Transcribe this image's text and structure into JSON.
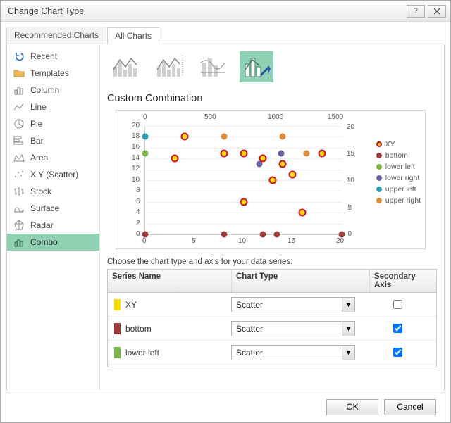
{
  "title": "Change Chart Type",
  "tabs": {
    "recommended": "Recommended Charts",
    "all": "All Charts"
  },
  "sidebar": {
    "items": [
      {
        "label": "Recent",
        "icon": "undo"
      },
      {
        "label": "Templates",
        "icon": "folder"
      },
      {
        "label": "Column",
        "icon": "column"
      },
      {
        "label": "Line",
        "icon": "line"
      },
      {
        "label": "Pie",
        "icon": "pie"
      },
      {
        "label": "Bar",
        "icon": "bar"
      },
      {
        "label": "Area",
        "icon": "area"
      },
      {
        "label": "X Y (Scatter)",
        "icon": "scatter"
      },
      {
        "label": "Stock",
        "icon": "stock"
      },
      {
        "label": "Surface",
        "icon": "surface"
      },
      {
        "label": "Radar",
        "icon": "radar"
      },
      {
        "label": "Combo",
        "icon": "combo"
      }
    ],
    "selected": 11
  },
  "section_title": "Custom Combination",
  "instruction": "Choose the chart type and axis for your data series:",
  "table": {
    "headers": {
      "name": "Series Name",
      "type": "Chart Type",
      "sec": "Secondary Axis"
    },
    "rows": [
      {
        "name": "XY",
        "type": "Scatter",
        "color": "#ffdb00",
        "secondary": false
      },
      {
        "name": "bottom",
        "type": "Scatter",
        "color": "#9e3c3c",
        "secondary": true
      },
      {
        "name": "lower left",
        "type": "Scatter",
        "color": "#7ab648",
        "secondary": true
      }
    ]
  },
  "buttons": {
    "ok": "OK",
    "cancel": "Cancel"
  },
  "legend": [
    {
      "name": "XY",
      "color": "#c8102e",
      "ring": true
    },
    {
      "name": "bottom",
      "color": "#9e3c3c"
    },
    {
      "name": "lower left",
      "color": "#7ab648"
    },
    {
      "name": "lower right",
      "color": "#6b5ca5"
    },
    {
      "name": "upper left",
      "color": "#2f9ab0"
    },
    {
      "name": "upper right",
      "color": "#e08a3b"
    }
  ],
  "chart_data": {
    "type": "scatter",
    "title": "",
    "x_primary": {
      "min": 0,
      "max": 20,
      "ticks": [
        0,
        5,
        10,
        15,
        20
      ],
      "label": ""
    },
    "y_primary": {
      "min": 0,
      "max": 20,
      "ticks": [
        0,
        2,
        4,
        6,
        8,
        10,
        12,
        14,
        16,
        18,
        20
      ],
      "label": ""
    },
    "x_secondary": {
      "min": 0,
      "max": 1500,
      "ticks": [
        0,
        500,
        1000,
        1500
      ]
    },
    "series": [
      {
        "name": "XY",
        "axis": "primary",
        "points": [
          [
            3,
            14
          ],
          [
            4,
            18
          ],
          [
            8,
            15
          ],
          [
            10,
            15
          ],
          [
            10,
            6
          ],
          [
            12,
            14
          ],
          [
            13,
            10
          ],
          [
            14,
            13
          ],
          [
            15,
            11
          ],
          [
            16,
            4
          ],
          [
            18,
            15
          ]
        ]
      },
      {
        "name": "bottom",
        "axis": "secondary",
        "points": [
          [
            0,
            0
          ],
          [
            600,
            0
          ],
          [
            900,
            0
          ],
          [
            1000,
            0
          ],
          [
            1500,
            0
          ]
        ]
      },
      {
        "name": "lower left",
        "axis": "secondary",
        "points": [
          [
            0,
            15
          ],
          [
            0,
            18
          ]
        ]
      },
      {
        "name": "lower right",
        "axis": "secondary",
        "points": [
          [
            1030,
            15
          ],
          [
            870,
            13
          ]
        ]
      },
      {
        "name": "upper left",
        "axis": "secondary",
        "points": [
          [
            0,
            18
          ]
        ]
      },
      {
        "name": "upper right",
        "axis": "secondary",
        "points": [
          [
            600,
            18
          ],
          [
            1050,
            18
          ],
          [
            1230,
            15
          ]
        ]
      }
    ]
  }
}
